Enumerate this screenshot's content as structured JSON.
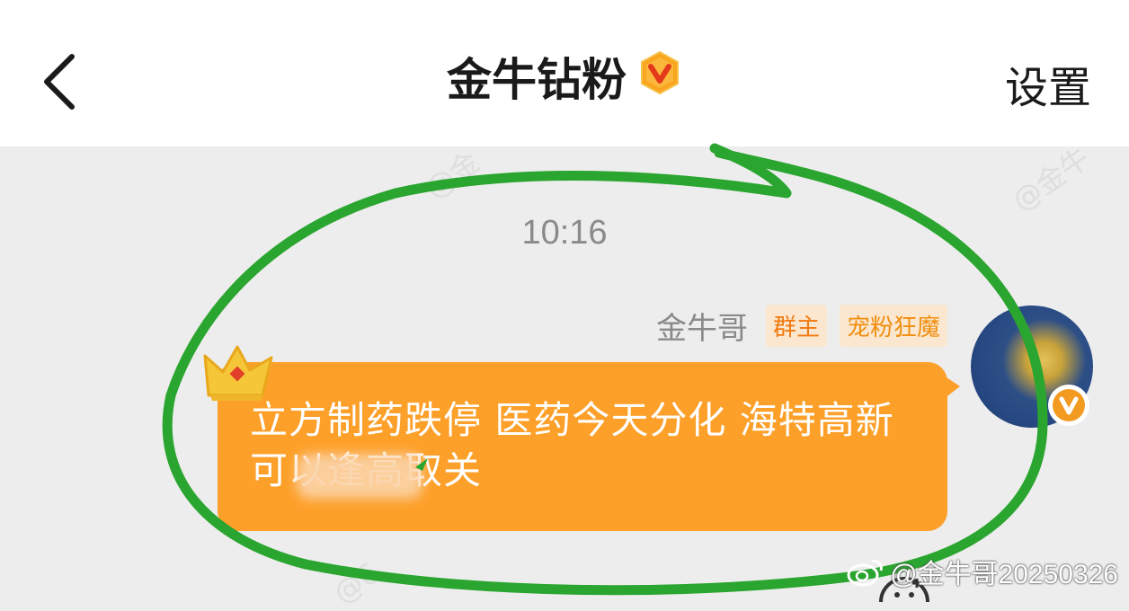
{
  "header": {
    "title": "金牛钻粉",
    "settings_label": "设置",
    "back_icon": "chevron-left-icon",
    "verified_icon": "verified-v-badge-icon"
  },
  "chat": {
    "timestamp": "10:16",
    "message": {
      "sender": "金牛哥",
      "tags": [
        "群主",
        "宠粉狂魔"
      ],
      "text": "立方制药跌停 医药今天分化 海特高新可以逢高取关",
      "bubble_color": "#fda02a"
    }
  },
  "watermark": {
    "credit": "@金牛哥20250326"
  },
  "colors": {
    "annotation_stroke": "#2aa52f",
    "owner_tag": "#f07a10",
    "fan_tag": "#f08e10"
  }
}
